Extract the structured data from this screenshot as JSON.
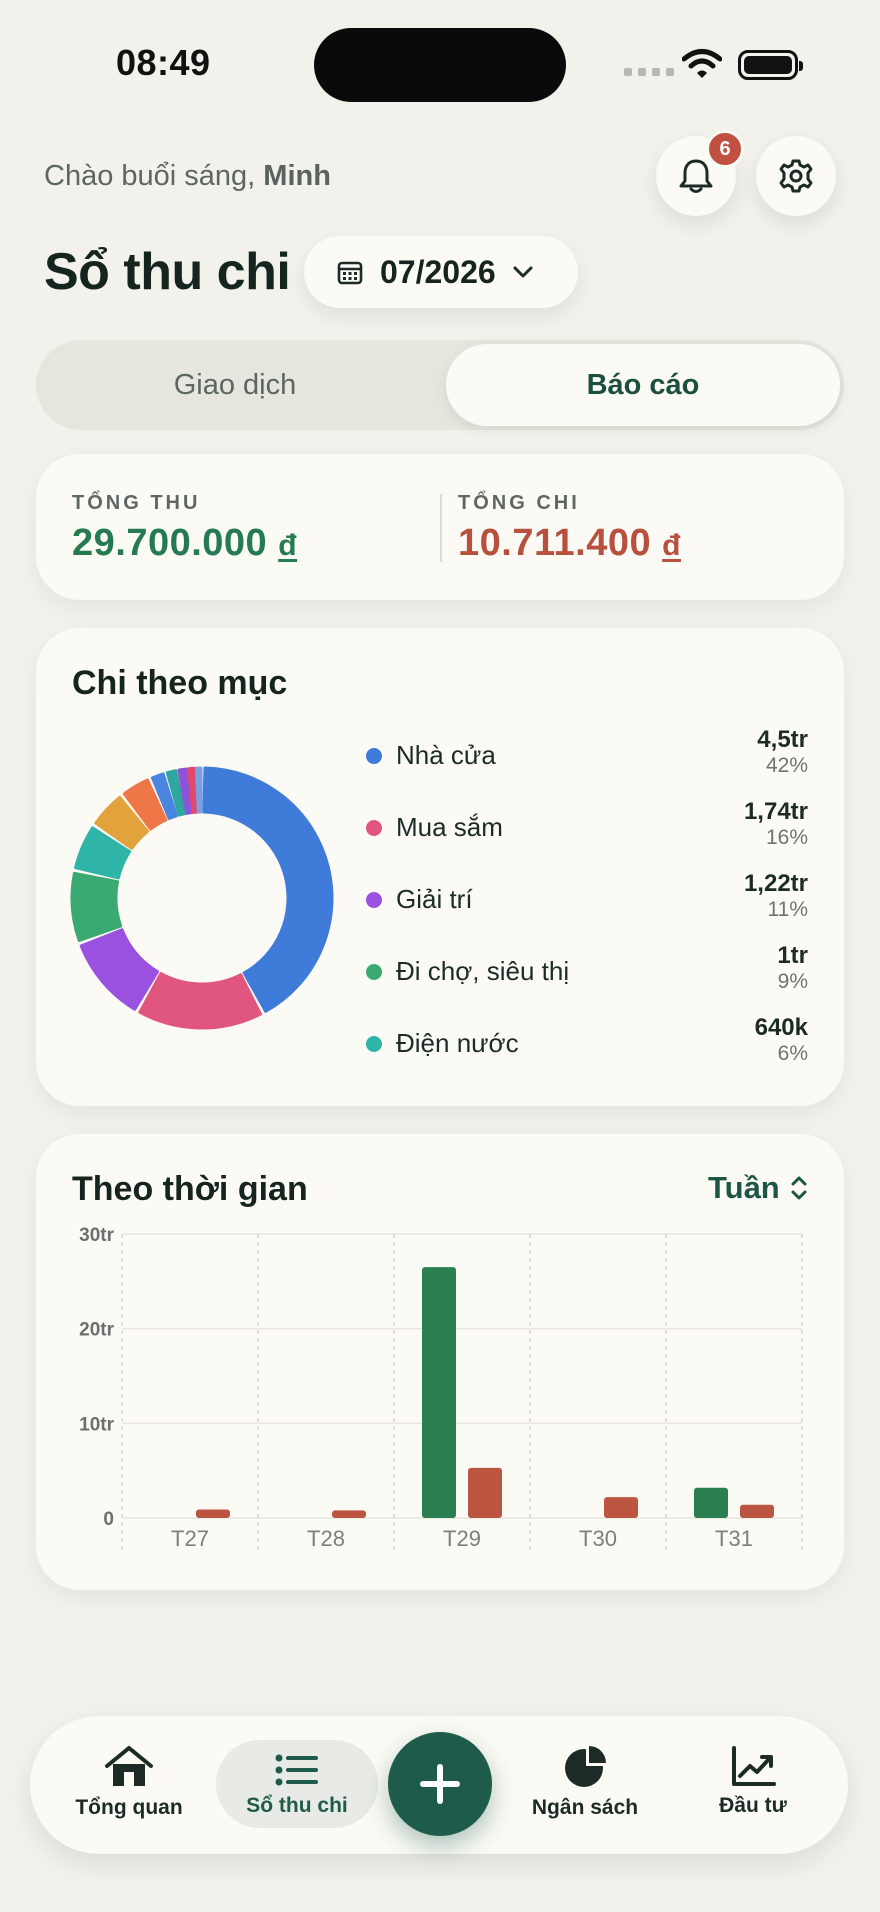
{
  "status_bar": {
    "time": "08:49"
  },
  "header": {
    "greeting_prefix": "Chào buổi sáng, ",
    "greeting_name": "Minh",
    "title": "Sổ thu chi",
    "month": "07/2026",
    "notification_count": "6"
  },
  "tabs": [
    {
      "label": "Giao dịch",
      "active": false
    },
    {
      "label": "Báo cáo",
      "active": true
    }
  ],
  "totals": {
    "income_label": "TỔNG THU",
    "income_value": "29.700.000",
    "expense_label": "TỔNG CHI",
    "expense_value": "10.711.400",
    "currency": "đ"
  },
  "category_card": {
    "title": "Chi theo mục",
    "items": [
      {
        "name": "Nhà cửa",
        "amount": "4,5tr",
        "percent": "42%",
        "color": "#3f7bd8"
      },
      {
        "name": "Mua sắm",
        "amount": "1,74tr",
        "percent": "16%",
        "color": "#e0567e"
      },
      {
        "name": "Giải trí",
        "amount": "1,22tr",
        "percent": "11%",
        "color": "#9b51e0"
      },
      {
        "name": "Đi chợ, siêu thị",
        "amount": "1tr",
        "percent": "9%",
        "color": "#3aaa72"
      },
      {
        "name": "Điện nước",
        "amount": "640k",
        "percent": "6%",
        "color": "#2fb5a8"
      }
    ]
  },
  "donut_chart": {
    "type": "pie",
    "slices": [
      {
        "value": 42,
        "color": "#3f7bd8"
      },
      {
        "value": 16,
        "color": "#e0567e"
      },
      {
        "value": 11,
        "color": "#9b51e0"
      },
      {
        "value": 9,
        "color": "#3aaa72"
      },
      {
        "value": 6,
        "color": "#2fb5a8"
      },
      {
        "value": 5,
        "color": "#e2a33c"
      },
      {
        "value": 4,
        "color": "#ef7647"
      },
      {
        "value": 2,
        "color": "#4a86e0"
      },
      {
        "value": 1.5,
        "color": "#2fa6a0"
      },
      {
        "value": 1.2,
        "color": "#8e53d8"
      },
      {
        "value": 1,
        "color": "#e04a6a"
      },
      {
        "value": 0.8,
        "color": "#7aa0e6"
      }
    ]
  },
  "time_card": {
    "title": "Theo thời gian",
    "period": "Tuần"
  },
  "chart_data": {
    "type": "bar",
    "categories": [
      "T27",
      "T28",
      "T29",
      "T30",
      "T31"
    ],
    "series": [
      {
        "values": [
          0,
          0,
          26.5,
          0,
          3.2
        ],
        "color": "#2a8050"
      },
      {
        "values": [
          0.9,
          0.8,
          5.3,
          2.2,
          1.4
        ],
        "color": "#bc5640"
      }
    ],
    "yticks": [
      0,
      10,
      20,
      30
    ],
    "ytick_labels": [
      "0",
      "10tr",
      "20tr",
      "30tr"
    ],
    "ylim": [
      0,
      30
    ],
    "grid": true
  },
  "nav": {
    "overview": "Tổng quan",
    "ledger": "Sổ thu chi",
    "budget": "Ngân sách",
    "invest": "Đầu tư"
  }
}
